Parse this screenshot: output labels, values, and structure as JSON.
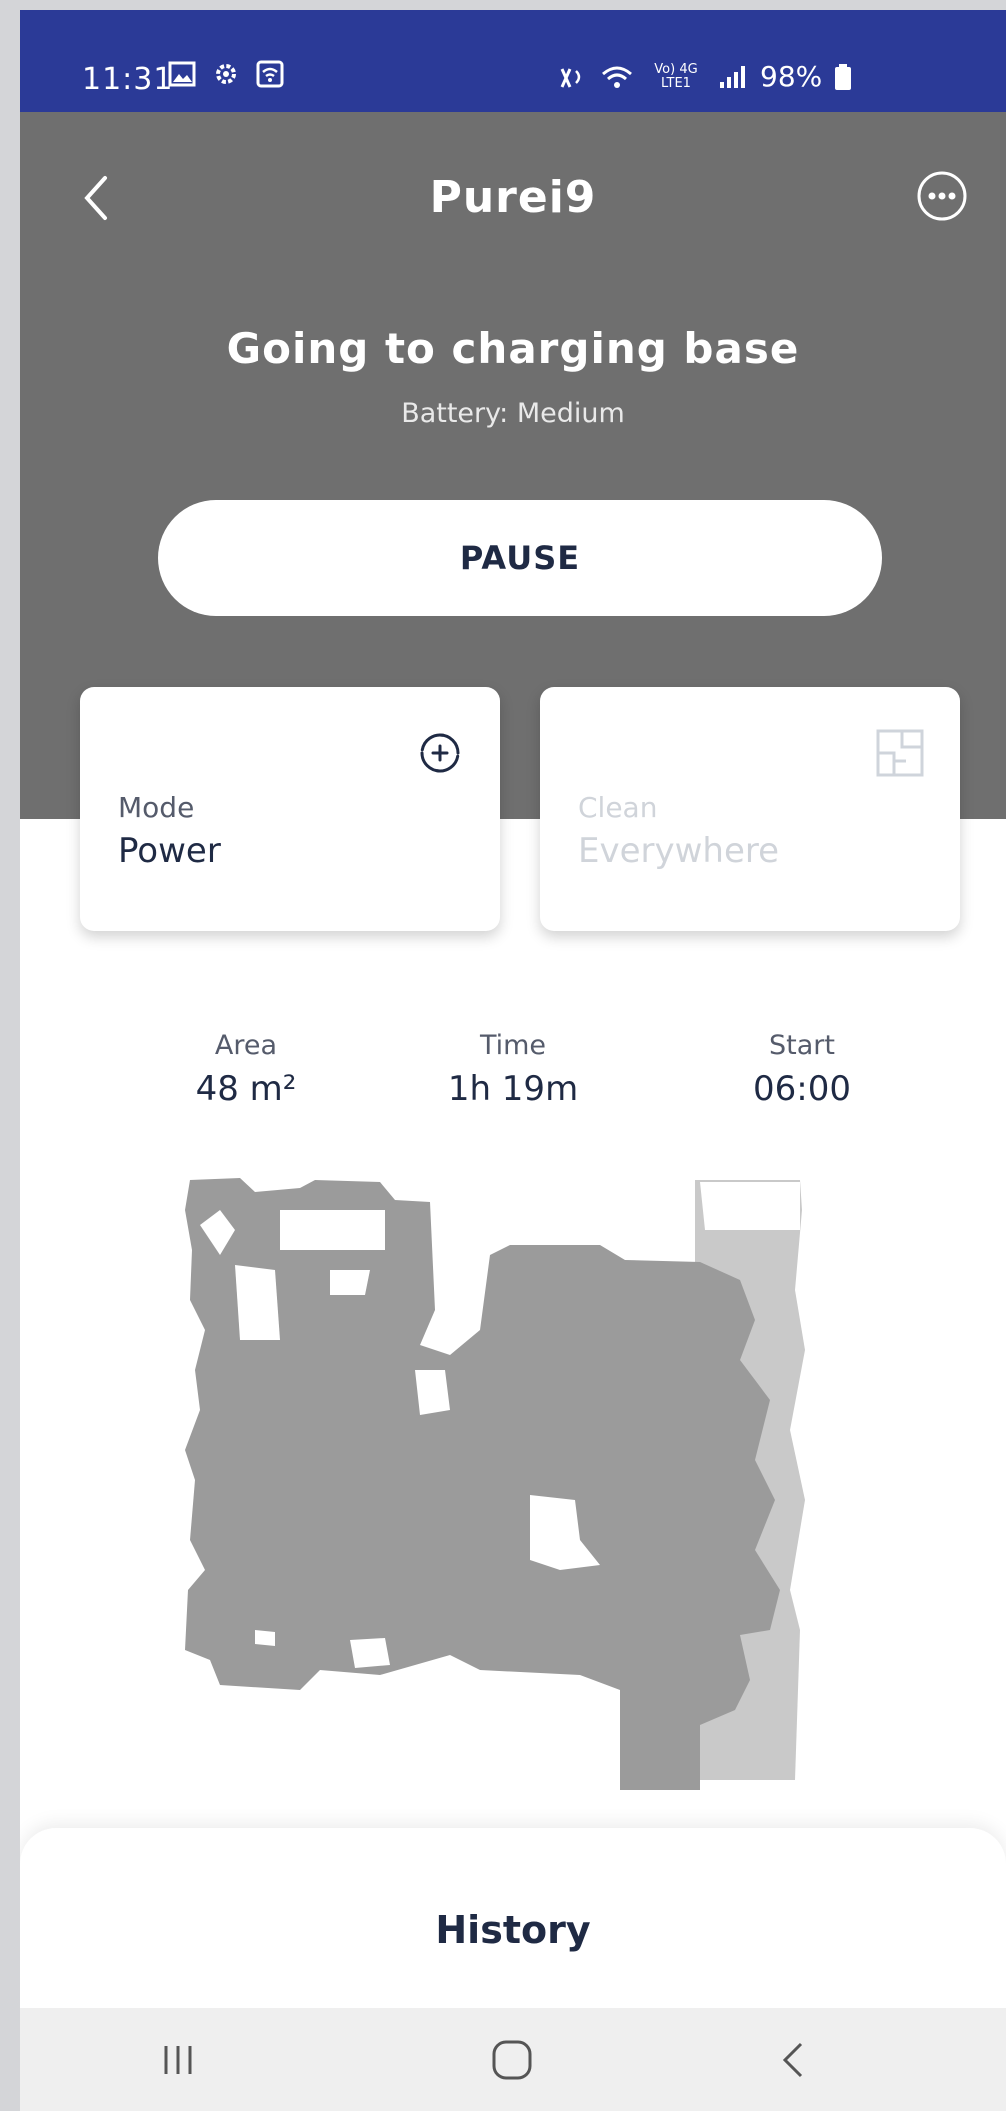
{
  "status_bar": {
    "time": "11:31",
    "icons_left": [
      "gallery-icon",
      "settings-icon",
      "wifi-calling-icon"
    ],
    "network_badge": "Vo) 4G LTE1",
    "battery": "98%"
  },
  "header": {
    "title": "Purei9",
    "back_icon": "chevron-left-icon",
    "more_icon": "more-horizontal-icon"
  },
  "status": {
    "state": "Going to charging base",
    "battery_text": "Battery: Medium",
    "action_label": "PAUSE"
  },
  "cards": [
    {
      "label": "Mode",
      "value": "Power",
      "icon": "fan-power-icon",
      "enabled": true
    },
    {
      "label": "Clean",
      "value": "Everywhere",
      "icon": "floor-plan-icon",
      "enabled": false
    }
  ],
  "stats": [
    {
      "label": "Area",
      "value": "48 m²"
    },
    {
      "label": "Time",
      "value": "1h 19m"
    },
    {
      "label": "Start",
      "value": "06:00"
    }
  ],
  "history": {
    "title": "History"
  },
  "nav": {
    "items": [
      "recent-apps-icon",
      "home-icon",
      "back-icon"
    ]
  },
  "colors": {
    "status_bar": "#2b3a97",
    "hero": "#6f6f6f",
    "text_dark": "#1f2a44",
    "map_dark": "#9b9b9b",
    "map_light": "#c9c9c9"
  }
}
